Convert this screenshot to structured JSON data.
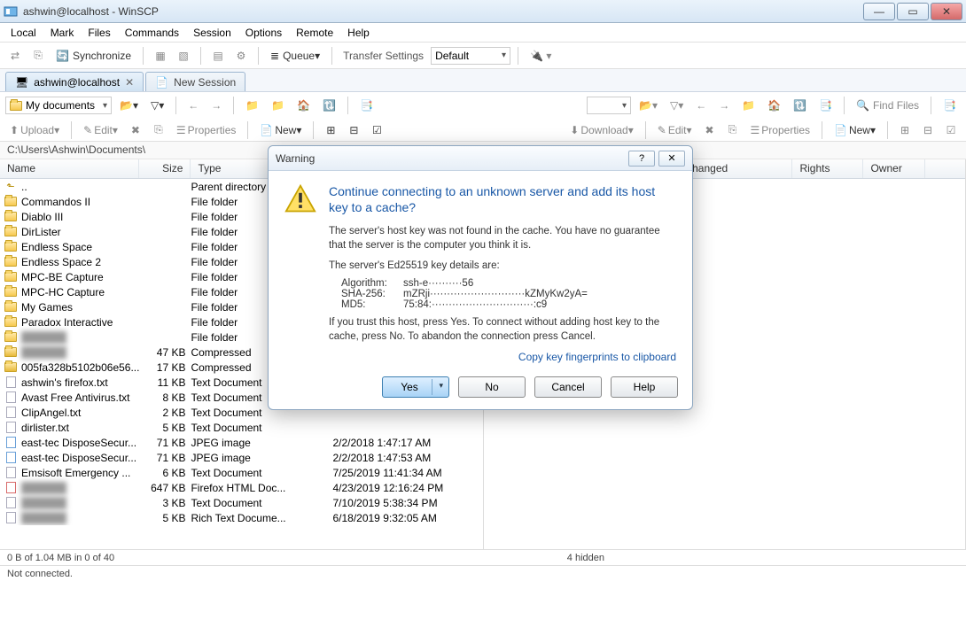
{
  "window": {
    "title": "ashwin@localhost - WinSCP"
  },
  "menu": [
    "Local",
    "Mark",
    "Files",
    "Commands",
    "Session",
    "Options",
    "Remote",
    "Help"
  ],
  "toolbar": {
    "sync": "Synchronize",
    "queue": "Queue",
    "transfer_label": "Transfer Settings",
    "transfer_value": "Default"
  },
  "tabs": {
    "session": "ashwin@localhost",
    "new": "New Session"
  },
  "nav": {
    "location": "My documents",
    "find": "Find Files"
  },
  "actions": {
    "upload": "Upload",
    "download": "Download",
    "edit": "Edit",
    "properties": "Properties",
    "new": "New"
  },
  "path": "C:\\Users\\Ashwin\\Documents\\",
  "columns": {
    "name": "Name",
    "size": "Size",
    "type": "Type",
    "changed": "Changed",
    "rights": "Rights",
    "owner": "Owner"
  },
  "rows": [
    {
      "icon": "up",
      "name": "..",
      "size": "",
      "type": "Parent directory",
      "changed": ""
    },
    {
      "icon": "folder",
      "name": "Commandos II",
      "size": "",
      "type": "File folder",
      "changed": ""
    },
    {
      "icon": "folder",
      "name": "Diablo III",
      "size": "",
      "type": "File folder",
      "changed": ""
    },
    {
      "icon": "folder",
      "name": "DirLister",
      "size": "",
      "type": "File folder",
      "changed": ""
    },
    {
      "icon": "folder",
      "name": "Endless Space",
      "size": "",
      "type": "File folder",
      "changed": ""
    },
    {
      "icon": "folder",
      "name": "Endless Space 2",
      "size": "",
      "type": "File folder",
      "changed": ""
    },
    {
      "icon": "folder",
      "name": "MPC-BE Capture",
      "size": "",
      "type": "File folder",
      "changed": ""
    },
    {
      "icon": "folder",
      "name": "MPC-HC Capture",
      "size": "",
      "type": "File folder",
      "changed": ""
    },
    {
      "icon": "folder",
      "name": "My Games",
      "size": "",
      "type": "File folder",
      "changed": ""
    },
    {
      "icon": "folder",
      "name": "Paradox Interactive",
      "size": "",
      "type": "File folder",
      "changed": ""
    },
    {
      "icon": "folder",
      "name": "",
      "size": "",
      "type": "File folder",
      "changed": "",
      "blur": true
    },
    {
      "icon": "zip",
      "name": "",
      "size": "47 KB",
      "type": "Compressed",
      "changed": "",
      "blur": true
    },
    {
      "icon": "zip",
      "name": "005fa328b5102b06e56...",
      "size": "17 KB",
      "type": "Compressed",
      "changed": ""
    },
    {
      "icon": "file",
      "name": "ashwin's firefox.txt",
      "size": "11 KB",
      "type": "Text Document",
      "changed": ""
    },
    {
      "icon": "file",
      "name": "Avast Free Antivirus.txt",
      "size": "8 KB",
      "type": "Text Document",
      "changed": ""
    },
    {
      "icon": "file",
      "name": "ClipAngel.txt",
      "size": "2 KB",
      "type": "Text Document",
      "changed": ""
    },
    {
      "icon": "file",
      "name": "dirlister.txt",
      "size": "5 KB",
      "type": "Text Document",
      "changed": ""
    },
    {
      "icon": "img",
      "name": "east-tec DisposeSecur...",
      "size": "71 KB",
      "type": "JPEG image",
      "changed": "2/2/2018  1:47:17 AM"
    },
    {
      "icon": "img",
      "name": "east-tec DisposeSecur...",
      "size": "71 KB",
      "type": "JPEG image",
      "changed": "2/2/2018  1:47:53 AM"
    },
    {
      "icon": "file",
      "name": "Emsisoft Emergency ...",
      "size": "6 KB",
      "type": "Text Document",
      "changed": "7/25/2019  11:41:34 AM"
    },
    {
      "icon": "html",
      "name": "",
      "size": "647 KB",
      "type": "Firefox HTML Doc...",
      "changed": "4/23/2019  12:16:24 PM",
      "blur": true
    },
    {
      "icon": "file",
      "name": "",
      "size": "3 KB",
      "type": "Text Document",
      "changed": "7/10/2019  5:38:34 PM",
      "blur": true
    },
    {
      "icon": "file",
      "name": "",
      "size": "5 KB",
      "type": "Rich Text Docume...",
      "changed": "6/18/2019  9:32:05 AM",
      "blur": true
    }
  ],
  "status_left": "0 B of 1.04 MB in 0 of 40",
  "status_mid": "4 hidden",
  "status_conn": "Not connected.",
  "dialog": {
    "title": "Warning",
    "heading": "Continue connecting to an unknown server and add its host key to a cache?",
    "p1": "The server's host key was not found in the cache. You have no guarantee that the server is the computer you think it is.",
    "p2": "The server's Ed25519 key details are:",
    "algo_k": "Algorithm:",
    "algo_v": "ssh-e··········56",
    "sha_k": "SHA-256:",
    "sha_v": "mZRji····························kZMyKw2yA=",
    "md5_k": "MD5:",
    "md5_v": "75:84:······························:c9",
    "p3": "If you trust this host, press Yes. To connect without adding host key to the cache, press No. To abandon the connection press Cancel.",
    "link": "Copy key fingerprints to clipboard",
    "yes": "Yes",
    "no": "No",
    "cancel": "Cancel",
    "help": "Help"
  }
}
